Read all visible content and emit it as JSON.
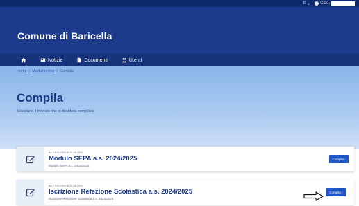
{
  "topbar": {
    "language": "it",
    "language_caret": "⌄",
    "user_greeting": "Ciao,"
  },
  "header": {
    "site_title": "Comune di Baricella"
  },
  "nav": {
    "items": [
      {
        "label": "",
        "icon": "home-icon"
      },
      {
        "label": "Notizie",
        "icon": "newspaper-icon"
      },
      {
        "label": "Documenti",
        "icon": "document-icon"
      },
      {
        "label": "Utenti",
        "icon": "users-icon"
      }
    ]
  },
  "breadcrumb": {
    "home": "Home",
    "moduli": "Moduli online",
    "current": "Compila",
    "separator": "/"
  },
  "page": {
    "title": "Compila",
    "subtitle": "Seleziona il modulo che si desidera compilare"
  },
  "cards": [
    {
      "dates": "dal 03.06.2024 al 31.08.2024",
      "title": "Modulo SEPA a.s. 2024/2025",
      "description": "Modulo SEPA a.s. 2024/2025",
      "button_label": "Compila ›"
    },
    {
      "dates": "dal 27.05.2024 al 31.08.2024",
      "title": "Iscrizione Refezione Scolastica a.s. 2024/2025",
      "description": "Iscrizione Refezione Scolastica a.s. 2024/2025",
      "button_label": "Compila ›"
    }
  ],
  "colors": {
    "header_bg": "#1c3b8c",
    "nav_bg": "#15327a",
    "hero_bg": "#a9c9f0",
    "title": "#1a3a86",
    "button": "#1f56c7"
  }
}
